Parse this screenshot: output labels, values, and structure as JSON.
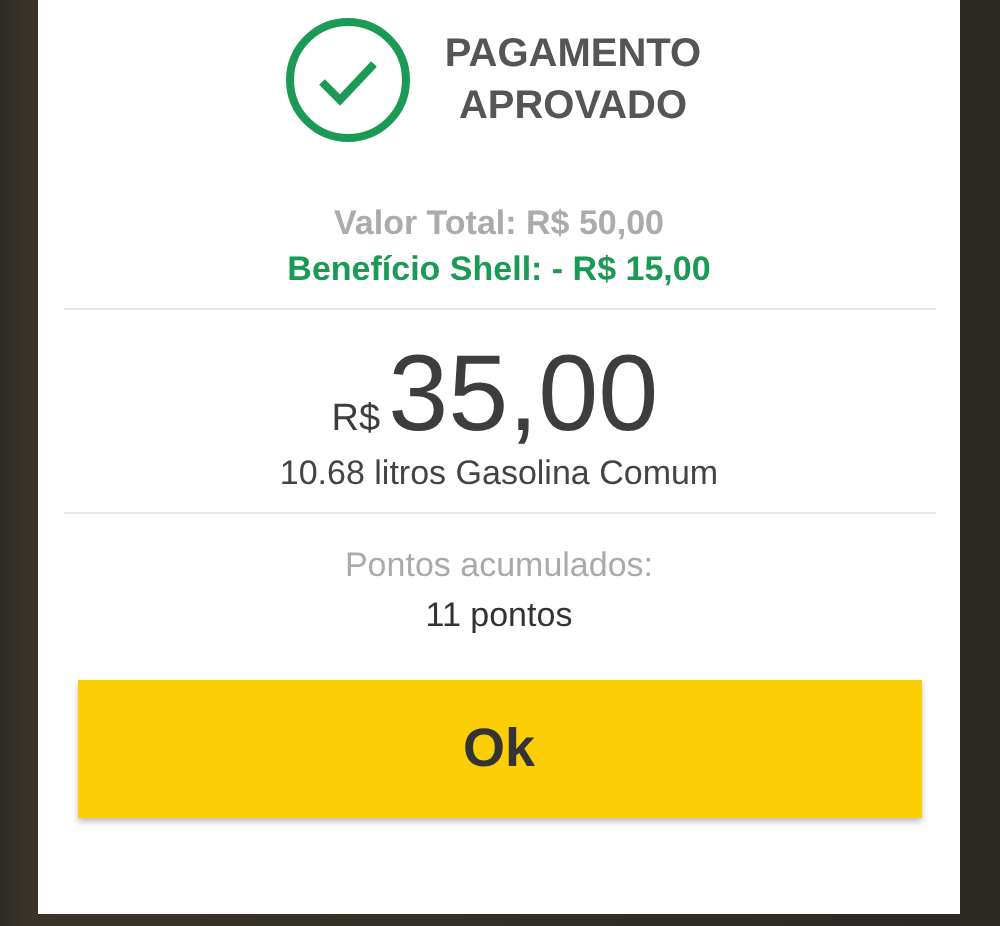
{
  "status": {
    "title_lines": [
      "PAGAMENTO",
      "APROVADO"
    ]
  },
  "summary": {
    "total": "Valor Total: R$ 50,00",
    "benefit": "Benefício Shell: - R$ 15,00"
  },
  "amount": {
    "currency": "R$",
    "value": "35,00",
    "detail": "10.68 litros Gasolina Comum"
  },
  "points": {
    "label": "Pontos acumulados:",
    "value": "11 pontos"
  },
  "button": {
    "label": "Ok"
  }
}
